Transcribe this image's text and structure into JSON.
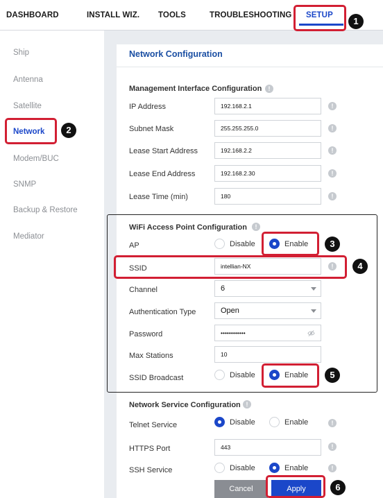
{
  "topnav": {
    "tabs": [
      "DASHBOARD",
      "INSTALL WIZ.",
      "TOOLS",
      "TROUBLESHOOTING",
      "SETUP"
    ]
  },
  "sidebar": {
    "items": [
      "Ship",
      "Antenna",
      "Satellite",
      "Network",
      "Modem/BUC",
      "SNMP",
      "Backup & Restore",
      "Mediator"
    ]
  },
  "page": {
    "title": "Network Configuration"
  },
  "management": {
    "title": "Management Interface Configuration",
    "ip_label": "IP Address",
    "ip_value": "192.168.2.1",
    "subnet_label": "Subnet Mask",
    "subnet_value": "255.255.255.0",
    "lease_start_label": "Lease Start Address",
    "lease_start_value": "192.168.2.2",
    "lease_end_label": "Lease End Address",
    "lease_end_value": "192.168.2.30",
    "lease_time_label": "Lease Time (min)",
    "lease_time_value": "180"
  },
  "wifi": {
    "title": "WiFi Access Point Configuration",
    "ap_label": "AP",
    "ssid_label": "SSID",
    "ssid_value": "intellian-NX",
    "channel_label": "Channel",
    "channel_value": "6",
    "auth_label": "Authentication Type",
    "auth_value": "Open",
    "password_label": "Password",
    "password_value": "••••••••••••",
    "max_stations_label": "Max Stations",
    "max_stations_value": "10",
    "ssid_broadcast_label": "SSID Broadcast"
  },
  "service": {
    "title": "Network Service Configuration",
    "telnet_label": "Telnet Service",
    "https_label": "HTTPS Port",
    "https_value": "443",
    "ssh_label": "SSH Service"
  },
  "radio": {
    "disable": "Disable",
    "enable": "Enable"
  },
  "buttons": {
    "cancel": "Cancel",
    "apply": "Apply"
  },
  "markers": [
    "1",
    "2",
    "3",
    "4",
    "5",
    "6"
  ],
  "icons": {
    "info": "!",
    "info_icon_name": "info-icon",
    "eye_icon_name": "eye-icon",
    "caret_icon_name": "chevron-down-icon"
  },
  "colors": {
    "accent": "#1b47c9",
    "highlight": "#d21f33",
    "title": "#1b4fa3"
  }
}
